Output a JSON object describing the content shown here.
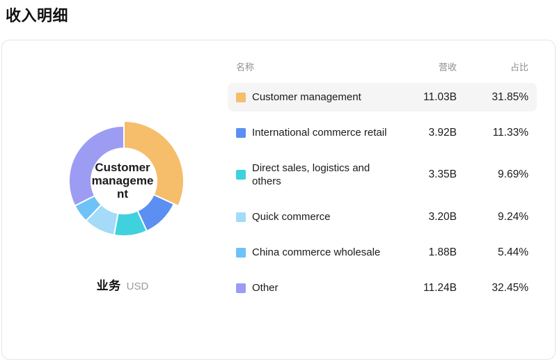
{
  "page_title": "收入明细",
  "card": {
    "axis_name": "业务",
    "unit": "USD"
  },
  "table": {
    "headers": {
      "name": "名称",
      "revenue": "营收",
      "share": "占比"
    },
    "rows": [
      {
        "name": "Customer management",
        "revenue": "11.03B",
        "share": "31.85%",
        "color": "#F6BD6B",
        "selected": true
      },
      {
        "name": "International commerce retail",
        "revenue": "3.92B",
        "share": "11.33%",
        "color": "#5B8FF2",
        "selected": false
      },
      {
        "name": "Direct sales, logistics and others",
        "revenue": "3.35B",
        "share": "9.69%",
        "color": "#40D1DE",
        "selected": false
      },
      {
        "name": "Quick commerce",
        "revenue": "3.20B",
        "share": "9.24%",
        "color": "#A3DBF8",
        "selected": false
      },
      {
        "name": "China commerce wholesale",
        "revenue": "1.88B",
        "share": "5.44%",
        "color": "#6EC2F7",
        "selected": false
      },
      {
        "name": "Other",
        "revenue": "11.24B",
        "share": "32.45%",
        "color": "#9C9CF3",
        "selected": false
      }
    ]
  },
  "chart": {
    "center_label": "Customer management"
  },
  "chart_data": {
    "type": "pie",
    "donut": true,
    "title": "收入明细",
    "center_label": "Customer management",
    "dimension_label": "业务",
    "unit": "USD",
    "categories": [
      "Customer management",
      "International commerce retail",
      "Direct sales, logistics and others",
      "Quick commerce",
      "China commerce wholesale",
      "Other"
    ],
    "values_revenue_B": [
      11.03,
      3.92,
      3.35,
      3.2,
      1.88,
      11.24
    ],
    "values_percent": [
      31.85,
      11.33,
      9.69,
      9.24,
      5.44,
      32.45
    ],
    "colors": [
      "#F6BD6B",
      "#5B8FF2",
      "#40D1DE",
      "#A3DBF8",
      "#6EC2F7",
      "#9C9CF3"
    ],
    "selected_index": 0,
    "start_angle_deg": 0,
    "direction": "clockwise",
    "legend_position": "right-table"
  }
}
